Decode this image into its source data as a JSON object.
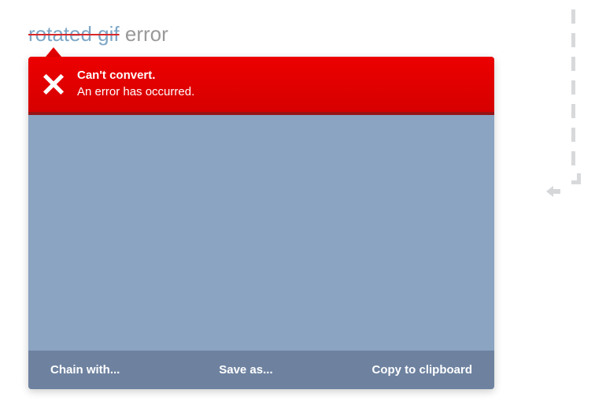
{
  "heading": {
    "struck_text": "rotated gif",
    "suffix": " error"
  },
  "error": {
    "title": "Can't convert.",
    "message": "An error has occurred."
  },
  "footer": {
    "chain": "Chain with...",
    "save": "Save as...",
    "copy": "Copy to clipboard"
  }
}
